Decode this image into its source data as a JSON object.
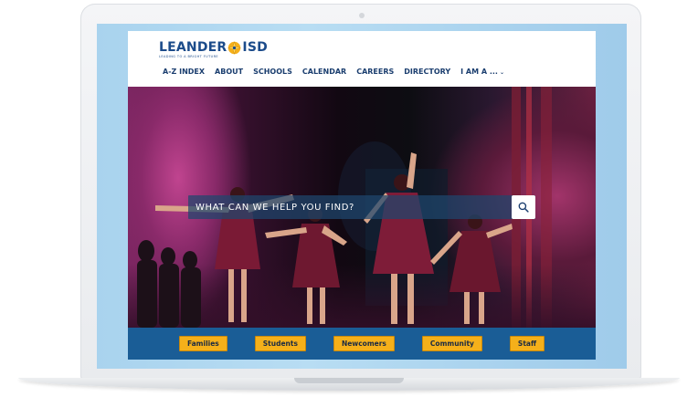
{
  "brand": {
    "name_left": "LEANDER",
    "name_right": "ISD",
    "tagline": "LEADING TO A BRIGHT FUTURE",
    "primary_color": "#1b4b8a",
    "accent_color": "#f5b01a"
  },
  "nav": {
    "items": [
      {
        "label": "A-Z INDEX"
      },
      {
        "label": "ABOUT"
      },
      {
        "label": "SCHOOLS"
      },
      {
        "label": "CALENDAR"
      },
      {
        "label": "CAREERS"
      },
      {
        "label": "DIRECTORY"
      },
      {
        "label": "I AM A ..."
      }
    ]
  },
  "search": {
    "placeholder": "WHAT CAN WE HELP YOU FIND?",
    "icon": "search-icon"
  },
  "audience": {
    "buttons": [
      {
        "label": "Families"
      },
      {
        "label": "Students"
      },
      {
        "label": "Newcomers"
      },
      {
        "label": "Community"
      },
      {
        "label": "Staff"
      }
    ],
    "bar_color": "#1a5d96"
  }
}
